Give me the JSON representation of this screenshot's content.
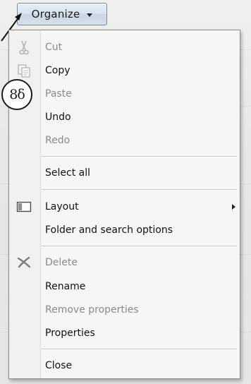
{
  "toolbar": {
    "organize_label": "Organize"
  },
  "annotation": {
    "marker": "8δ"
  },
  "menu": {
    "items": [
      {
        "label": "Cut",
        "enabled": false,
        "icon": "scissors-icon"
      },
      {
        "label": "Copy",
        "enabled": true,
        "icon": "copy-icon"
      },
      {
        "label": "Paste",
        "enabled": false,
        "icon": "paste-icon"
      },
      {
        "label": "Undo",
        "enabled": true
      },
      {
        "label": "Redo",
        "enabled": false
      },
      {
        "label": "Select all",
        "enabled": true
      },
      {
        "label": "Layout",
        "enabled": true,
        "icon": "layout-icon",
        "submenu": true
      },
      {
        "label": "Folder and search options",
        "enabled": true
      },
      {
        "label": "Delete",
        "enabled": false,
        "icon": "delete-x-icon"
      },
      {
        "label": "Rename",
        "enabled": true
      },
      {
        "label": "Remove properties",
        "enabled": false
      },
      {
        "label": "Properties",
        "enabled": true
      },
      {
        "label": "Close",
        "enabled": true
      }
    ]
  },
  "colors": {
    "menu_background": "#f6f6f4",
    "disabled_text": "#8a8a8a",
    "enabled_text": "#111111"
  }
}
